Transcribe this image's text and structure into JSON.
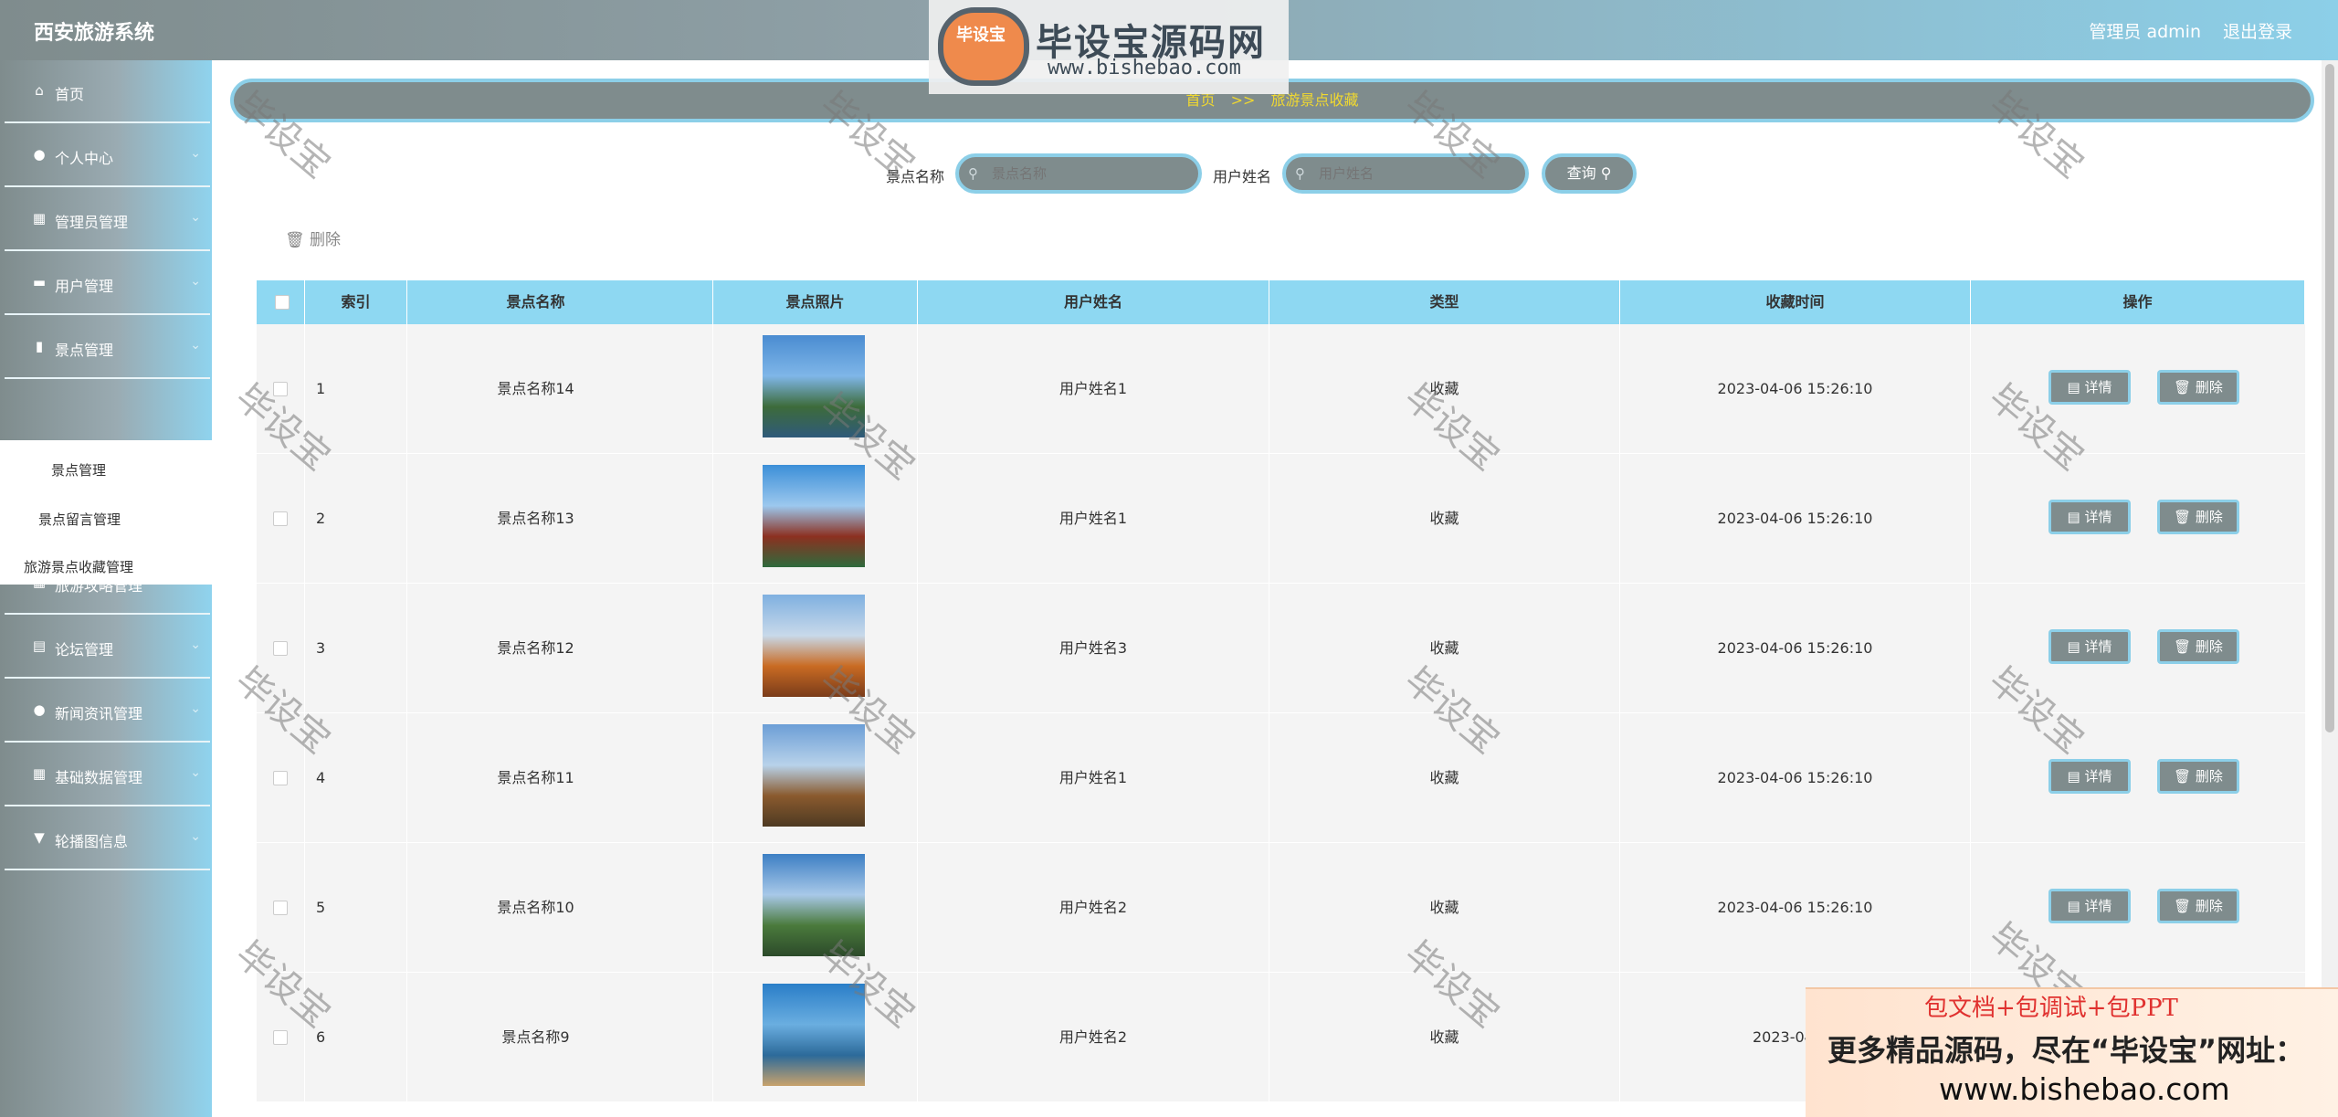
{
  "app": {
    "title": "西安旅游系统",
    "user_label": "管理员 admin",
    "logout_label": "退出登录"
  },
  "watermark": {
    "logo_seal": "毕设宝",
    "logo_text": "毕设宝源码网",
    "logo_url": "www.bishebao.com",
    "tile_text": "毕设宝"
  },
  "sidebar": {
    "items": [
      {
        "label": "首页",
        "icon": "home-icon",
        "glyph": "⌂",
        "has_children": false
      },
      {
        "label": "个人中心",
        "icon": "user-icon",
        "glyph": "●",
        "has_children": true
      },
      {
        "label": "管理员管理",
        "icon": "grid-icon",
        "glyph": "▦",
        "has_children": true
      },
      {
        "label": "用户管理",
        "icon": "chat-icon",
        "glyph": "▬",
        "has_children": true
      },
      {
        "label": "景点管理",
        "icon": "chart-icon",
        "glyph": "▮",
        "has_children": true
      },
      {
        "label": "旅游攻略管理",
        "icon": "grid-icon",
        "glyph": "▦",
        "has_children": true
      },
      {
        "label": "论坛管理",
        "icon": "clipboard-icon",
        "glyph": "▤",
        "has_children": true
      },
      {
        "label": "新闻资讯管理",
        "icon": "pin-icon",
        "glyph": "●",
        "has_children": true
      },
      {
        "label": "基础数据管理",
        "icon": "grid-icon",
        "glyph": "▦",
        "has_children": true
      },
      {
        "label": "轮播图信息",
        "icon": "cup-icon",
        "glyph": "▼",
        "has_children": true
      }
    ],
    "submenu": [
      "景点管理",
      "景点留言管理",
      "旅游景点收藏管理"
    ]
  },
  "breadcrumb": {
    "home": "首页",
    "separator": ">>",
    "current": "旅游景点收藏"
  },
  "search": {
    "field1_label": "景点名称",
    "field1_placeholder": "景点名称",
    "field2_label": "用户姓名",
    "field2_placeholder": "用户姓名",
    "query_label": "查询"
  },
  "toolbar": {
    "delete_label": "删除"
  },
  "table": {
    "columns": [
      "索引",
      "景点名称",
      "景点照片",
      "用户姓名",
      "类型",
      "收藏时间",
      "操作"
    ],
    "detail_label": "详情",
    "delete_label": "删除",
    "rows": [
      {
        "index": "1",
        "name": "景点名称14",
        "user": "用户姓名1",
        "type": "收藏",
        "time": "2023-04-06 15:26:10"
      },
      {
        "index": "2",
        "name": "景点名称13",
        "user": "用户姓名1",
        "type": "收藏",
        "time": "2023-04-06 15:26:10"
      },
      {
        "index": "3",
        "name": "景点名称12",
        "user": "用户姓名3",
        "type": "收藏",
        "time": "2023-04-06 15:26:10"
      },
      {
        "index": "4",
        "name": "景点名称11",
        "user": "用户姓名1",
        "type": "收藏",
        "time": "2023-04-06 15:26:10"
      },
      {
        "index": "5",
        "name": "景点名称10",
        "user": "用户姓名2",
        "type": "收藏",
        "time": "2023-04-06 15:26:10"
      },
      {
        "index": "6",
        "name": "景点名称9",
        "user": "用户姓名2",
        "type": "收藏",
        "time": "2023-04-06"
      }
    ]
  },
  "ad": {
    "line1": "包文档+包调试+包PPT",
    "line2": "更多精品源码，尽在“毕设宝”网址：",
    "line3": "www.bishebao.com"
  },
  "colors": {
    "accent": "#8ccfe8",
    "header_gray": "#7f8c8d",
    "table_head": "#8ed8f2",
    "breadcrumb_text": "#f0d830"
  }
}
